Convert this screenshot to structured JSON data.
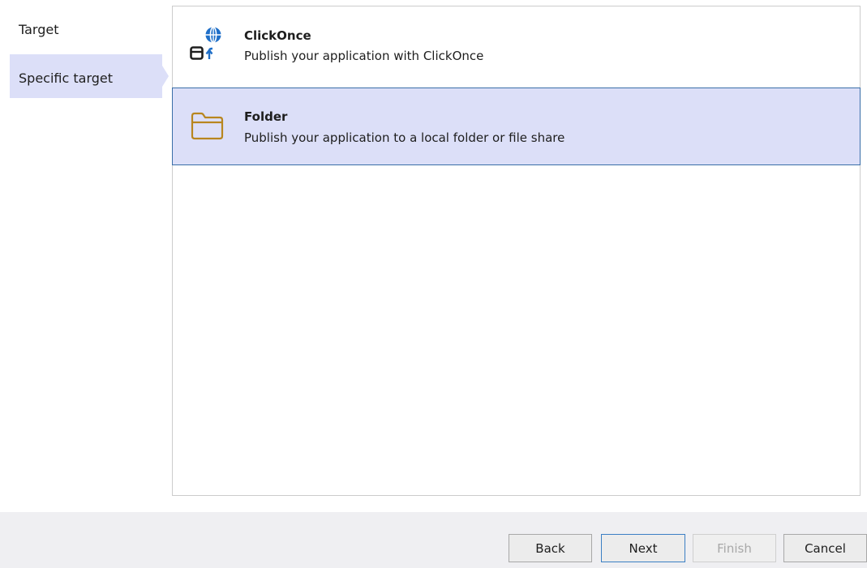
{
  "nav": {
    "items": [
      {
        "label": "Target",
        "selected": false
      },
      {
        "label": "Specific target",
        "selected": true
      }
    ]
  },
  "options": [
    {
      "title": "ClickOnce",
      "description": "Publish your application with ClickOnce",
      "icon": "clickonce-globe-upload-icon",
      "selected": false
    },
    {
      "title": "Folder",
      "description": "Publish your application to a local folder or file share",
      "icon": "folder-icon",
      "selected": true
    }
  ],
  "footer": {
    "back_label": "Back",
    "next_label": "Next",
    "finish_label": "Finish",
    "cancel_label": "Cancel",
    "finish_enabled": false
  },
  "colors": {
    "selection_background": "#dcdff8",
    "selection_border": "#3a6ea8",
    "icon_blue": "#1f6fc8",
    "folder_gold": "#b8861f",
    "footer_background": "#efeff2"
  }
}
